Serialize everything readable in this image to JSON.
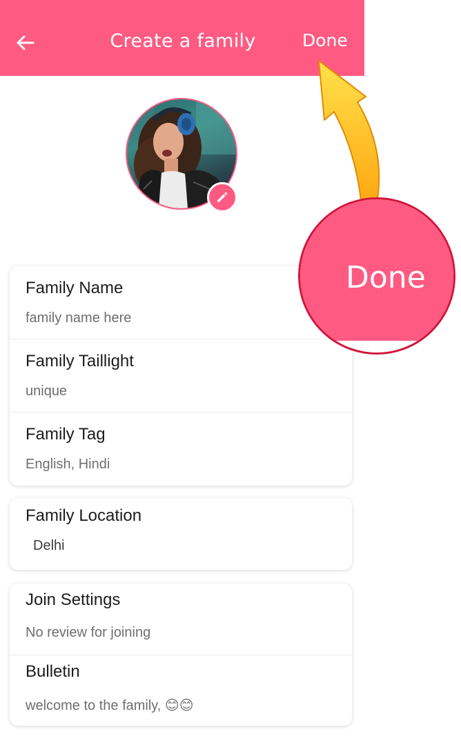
{
  "header": {
    "title": "Create a family",
    "done_label": "Done",
    "background_color": "#ff5a82",
    "back_icon": "arrow-left-icon"
  },
  "avatar": {
    "edit_icon": "pencil-icon"
  },
  "profile_section": {
    "fields": [
      {
        "label": "Family Name",
        "value": "family name here"
      },
      {
        "label": "Family Taillight",
        "value": "unique"
      },
      {
        "label": "Family Tag",
        "value": "English, Hindi"
      }
    ]
  },
  "location_section": {
    "label": "Family Location",
    "value": "Delhi"
  },
  "settings_section": {
    "fields": [
      {
        "label": "Join Settings",
        "value": "No review for joining"
      },
      {
        "label": "Bulletin",
        "value": "welcome to the family, 😊😊"
      }
    ]
  },
  "annotation": {
    "zoom_label": "Done",
    "arrow_color": "#ffc107",
    "circle_border_color": "#d2143a"
  }
}
